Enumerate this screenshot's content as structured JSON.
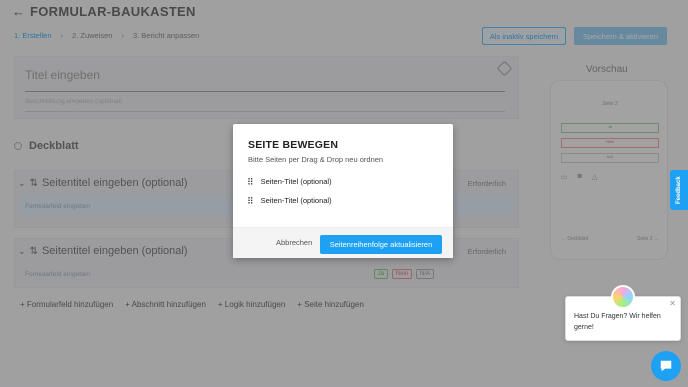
{
  "header": {
    "back_icon": "arrow-left-icon",
    "title": "FORMULAR-BAUKASTEN"
  },
  "steps": [
    {
      "label": "1. Erstellen",
      "active": true
    },
    {
      "label": "2. Zuweisen",
      "active": false
    },
    {
      "label": "3. Bericht anpassen",
      "active": false
    }
  ],
  "toolbar": {
    "save_inactive": "Als inaktiv speichern",
    "save_activate": "Speichern & aktivieren"
  },
  "form": {
    "title_placeholder": "Titel eingeben",
    "description_placeholder": "Beschreibung eingeben (optional)",
    "deckblatt": "Deckblatt",
    "sections": [
      {
        "title": "Seitentitel eingeben (optional)",
        "required_label": "Erforderlich",
        "field_placeholder": "Formularfeld eingeben"
      },
      {
        "title": "Seitentitel eingeben (optional)",
        "required_label": "Erforderlich",
        "field_placeholder": "Formularfeld eingeben",
        "answers": [
          "Ja",
          "Nein",
          "N/A"
        ]
      }
    ],
    "actions": [
      "+ Formularfeld hinzufügen",
      "+ Abschnitt hinzufügen",
      "+ Logik hinzufügen",
      "+ Seite hinzufügen"
    ]
  },
  "preview": {
    "label": "Vorschau",
    "page_title": "Seite 2",
    "answers": [
      "Ja",
      "Nein",
      "N/A"
    ],
    "prev": "Deckblatt",
    "next": "Seite 2"
  },
  "feedback": "Feedback",
  "modal": {
    "title": "SEITE BEWEGEN",
    "subtitle": "Bitte Seiten per Drag & Drop neu ordnen",
    "items": [
      "Seiten-Titel (optional)",
      "Seiten-Titel (optional)"
    ],
    "cancel": "Abbrechen",
    "confirm": "Seitenreihenfolge aktualisieren"
  },
  "chat": {
    "message": "Hast Du Fragen? Wir helfen gerne!",
    "close_icon": "close-icon"
  },
  "colors": {
    "accent": "#1ea1f2",
    "overlay": "rgba(60,60,60,0.45)"
  }
}
